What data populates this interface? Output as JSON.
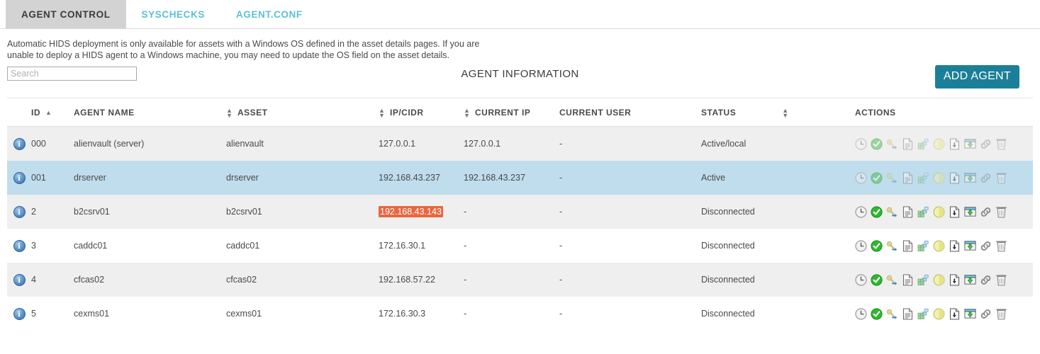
{
  "tabs": [
    {
      "label": "AGENT CONTROL",
      "active": true
    },
    {
      "label": "SYSCHECKS",
      "active": false
    },
    {
      "label": "AGENT.CONF",
      "active": false
    }
  ],
  "description": "Automatic HIDS deployment is only available for assets with a Windows OS defined in the asset details pages. If you are unable to deploy a HIDS agent to a Windows machine, you may need to update the OS field on the asset details.",
  "search": {
    "value": "",
    "placeholder": "Search"
  },
  "panel": {
    "title": "AGENT INFORMATION",
    "add_agent_label": "ADD AGENT",
    "add_agent_color": "#1b7f99"
  },
  "table": {
    "columns": [
      {
        "key": "info",
        "label": "",
        "sort": "none"
      },
      {
        "key": "id",
        "label": "ID",
        "sort": "asc"
      },
      {
        "key": "name",
        "label": "AGENT NAME",
        "sort": "both"
      },
      {
        "key": "asset",
        "label": "ASSET",
        "sort": "both"
      },
      {
        "key": "ipcidr",
        "label": "IP/CIDR",
        "sort": "both"
      },
      {
        "key": "currentip",
        "label": "CURRENT IP",
        "sort": "none"
      },
      {
        "key": "currentuser",
        "label": "CURRENT USER",
        "sort": "both"
      },
      {
        "key": "status",
        "label": "STATUS",
        "sort": "none"
      },
      {
        "key": "actions",
        "label": "ACTIONS",
        "sort": "none"
      }
    ],
    "rows": [
      {
        "id": "000",
        "name": "alienvault (server)",
        "asset": "alienvault",
        "ipcidr": "127.0.0.1",
        "ipcidr_highlighted": false,
        "currentip": "127.0.0.1",
        "currentuser": "-",
        "status": "Active/local",
        "rowstyle": "r-grey",
        "icons_dim": true
      },
      {
        "id": "001",
        "name": "drserver",
        "asset": "drserver",
        "ipcidr": "192.168.43.237",
        "ipcidr_highlighted": false,
        "currentip": "192.168.43.237",
        "currentuser": "-",
        "status": "Active",
        "rowstyle": "r-sel",
        "icons_dim": true
      },
      {
        "id": "2",
        "name": "b2csrv01",
        "asset": "b2csrv01",
        "ipcidr": "192.168.43.143",
        "ipcidr_highlighted": true,
        "currentip": "-",
        "currentuser": "-",
        "status": "Disconnected",
        "rowstyle": "r-grey",
        "icons_dim": false
      },
      {
        "id": "3",
        "name": "caddc01",
        "asset": "caddc01",
        "ipcidr": "172.16.30.1",
        "ipcidr_highlighted": false,
        "currentip": "-",
        "currentuser": "-",
        "status": "Disconnected",
        "rowstyle": "r-white",
        "icons_dim": false
      },
      {
        "id": "4",
        "name": "cfcas02",
        "asset": "cfcas02",
        "ipcidr": "192.168.57.22",
        "ipcidr_highlighted": false,
        "currentip": "-",
        "currentuser": "-",
        "status": "Disconnected",
        "rowstyle": "r-grey",
        "icons_dim": false
      },
      {
        "id": "5",
        "name": "cexms01",
        "asset": "cexms01",
        "ipcidr": "172.16.30.3",
        "ipcidr_highlighted": false,
        "currentip": "-",
        "currentuser": "-",
        "status": "Disconnected",
        "rowstyle": "r-white",
        "icons_dim": false
      }
    ],
    "action_icons": [
      "clock-icon",
      "check-circle-icon",
      "key-icon",
      "document-icon",
      "network-icon",
      "pie-icon",
      "download-file-icon",
      "deploy-window-icon",
      "link-icon",
      "trash-icon"
    ],
    "highlight_color": "#e8673f",
    "selected_row_color": "#bfdded"
  }
}
